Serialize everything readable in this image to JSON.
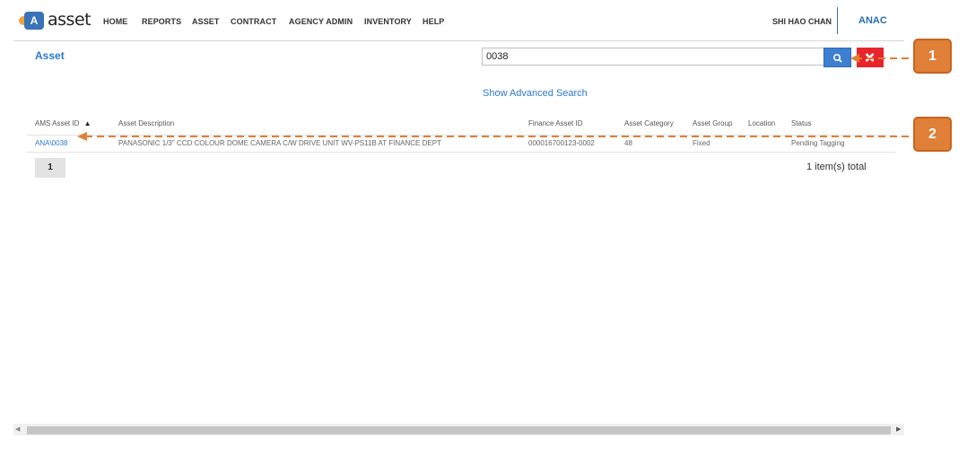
{
  "navbar": {
    "logo_letter": "A",
    "logo_text": "asset",
    "items": [
      "HOME",
      "REPORTS",
      "ASSET",
      "CONTRACT",
      "AGENCY ADMIN",
      "INVENTORY",
      "HELP"
    ],
    "user_name": "SHI HAO CHAN",
    "agency": "ANAC"
  },
  "page": {
    "title": "Asset",
    "search_value": "0038",
    "advanced_search_label": "Show Advanced Search"
  },
  "table": {
    "columns": [
      "AMS Asset ID",
      "Asset Description",
      "Finance Asset ID",
      "Asset Category",
      "Asset Group",
      "Location",
      "Status"
    ],
    "sort_indicator": "▲",
    "rows": [
      {
        "ams_asset_id": "ANA\\0038",
        "description": "PANASONIC 1/3\" CCD COLOUR DOME CAMERA C/W DRIVE UNIT WV-PS11B AT FINANCE DEPT",
        "finance_asset_id": "000016700123-0002",
        "category": "48",
        "group": "Fixed",
        "location": "",
        "status": "Pending Tagging"
      }
    ]
  },
  "pagination": {
    "current_page": "1",
    "total_label": "1 item(s) total"
  },
  "annotations": {
    "callout_1": "1",
    "callout_2": "2",
    "color": "#e07f38"
  },
  "icons": {
    "search": "search-icon",
    "clear": "close-icon"
  }
}
